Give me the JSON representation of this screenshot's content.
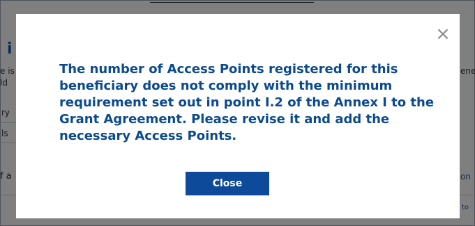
{
  "background": {
    "heading_fragment": "i",
    "left_fragments": [
      "e is",
      "ld",
      "ry",
      "ls",
      "f a"
    ],
    "right_fragments": [
      "ene",
      "on",
      "to"
    ]
  },
  "modal": {
    "close_icon_glyph": "×",
    "message": "The number of Access Points registered for this beneficiary does not comply with the minimum requirement set out in point I.2 of the Annex I to the Grant Agreement. Please revise it and add the necessary Access Points.",
    "close_button_label": "Close"
  }
}
